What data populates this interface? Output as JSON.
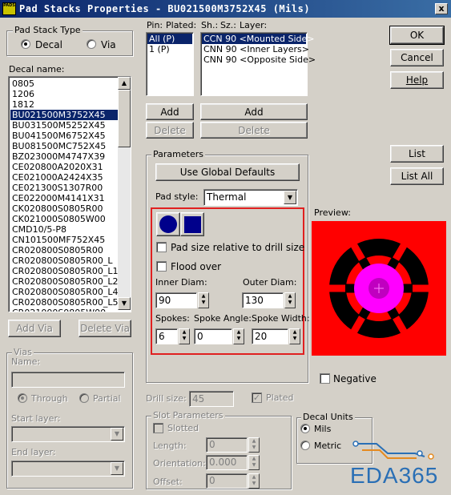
{
  "window": {
    "icon_text": "PADS",
    "title": "Pad Stacks Properties - BU021500M3752X45 (Mils)",
    "close_glyph": "x"
  },
  "pad_stack_type": {
    "label": "Pad Stack Type",
    "options": [
      {
        "label": "Decal",
        "checked": true
      },
      {
        "label": "Via",
        "checked": false
      }
    ]
  },
  "decal_name": {
    "label": "Decal name:",
    "items": [
      "0805",
      "1206",
      "1812",
      "BU021500M3752X45",
      "BU031500M5252X45",
      "BU041500M6752X45",
      "BU081500MC752X45",
      "BZ023000M4747X39",
      "CE020800A2020X31",
      "CE021000A2424X35",
      "CE021300S1307R00",
      "CE022000M4141X31",
      "CK020800S0805R00",
      "CK021000S0805W00",
      "CMD10/5-P8",
      "CN101500MF752X45",
      "CR020800S0805R00",
      "CR020800S0805R00_L",
      "CR020800S0805R00_L1",
      "CR020800S0805R00_L2",
      "CR020800S0805R00_L4",
      "CR020800S0805R00_L5",
      "CR021000S0805W00"
    ],
    "selected_index": 3
  },
  "via_buttons": {
    "add": "Add Via",
    "delete": "Delete Via"
  },
  "vias": {
    "group_label": "Vias",
    "name_label": "Name:",
    "through": "Through",
    "partial": "Partial",
    "start_layer": "Start layer:",
    "end_layer": "End layer:"
  },
  "pin_list": {
    "header_pin": "Pin:",
    "header_plated": "Plated:",
    "items": [
      "All (P)",
      "1 (P)"
    ],
    "selected_index": 0,
    "add": "Add",
    "delete": "Delete"
  },
  "layer_list": {
    "header_sh": "Sh.:",
    "header_sz": "Sz.:",
    "header_layer": "Layer:",
    "items": [
      "CCN 90 <Mounted Side>",
      "CNN 90 <Inner Layers>",
      "CNN 90 <Opposite Side>"
    ],
    "selected_index": 0,
    "add": "Add",
    "delete": "Delete"
  },
  "buttons": {
    "ok": "OK",
    "cancel": "Cancel",
    "help": "Help",
    "list": "List",
    "list_all": "List All"
  },
  "parameters": {
    "group_label": "Parameters",
    "use_global": "Use Global Defaults",
    "pad_style_label": "Pad style:",
    "pad_style_value": "Thermal",
    "pad_size_relative": "Pad size relative to drill size",
    "flood_over": "Flood over",
    "inner_diam_label": "Inner Diam:",
    "inner_diam_value": "90",
    "outer_diam_label": "Outer Diam:",
    "outer_diam_value": "130",
    "spokes_label": "Spokes:",
    "spokes_value": "6",
    "spoke_angle_label": "Spoke Angle:",
    "spoke_angle_value": "0",
    "spoke_width_label": "Spoke Width:",
    "spoke_width_value": "20",
    "highlight_color": "#e02020"
  },
  "preview": {
    "label": "Preview:",
    "background": "#ff0000",
    "ring_color": "#000000",
    "pad_color": "#ff00ff",
    "drill_color": "#c000c0",
    "negative": "Negative"
  },
  "drill": {
    "size_label": "Drill size:",
    "size_value": "45",
    "plated": "Plated",
    "plated_checked": true
  },
  "slot": {
    "group_label": "Slot Parameters",
    "slotted": "Slotted",
    "length_label": "Length:",
    "length_value": "0",
    "orientation_label": "Orientation:",
    "orientation_value": "0.000",
    "offset_label": "Offset:",
    "offset_value": "0"
  },
  "decal_units": {
    "group_label": "Decal Units",
    "mils": "Mils",
    "metric": "Metric",
    "mils_checked": true
  },
  "watermark": {
    "text": "EDA365",
    "color": "#2a6fb5"
  }
}
